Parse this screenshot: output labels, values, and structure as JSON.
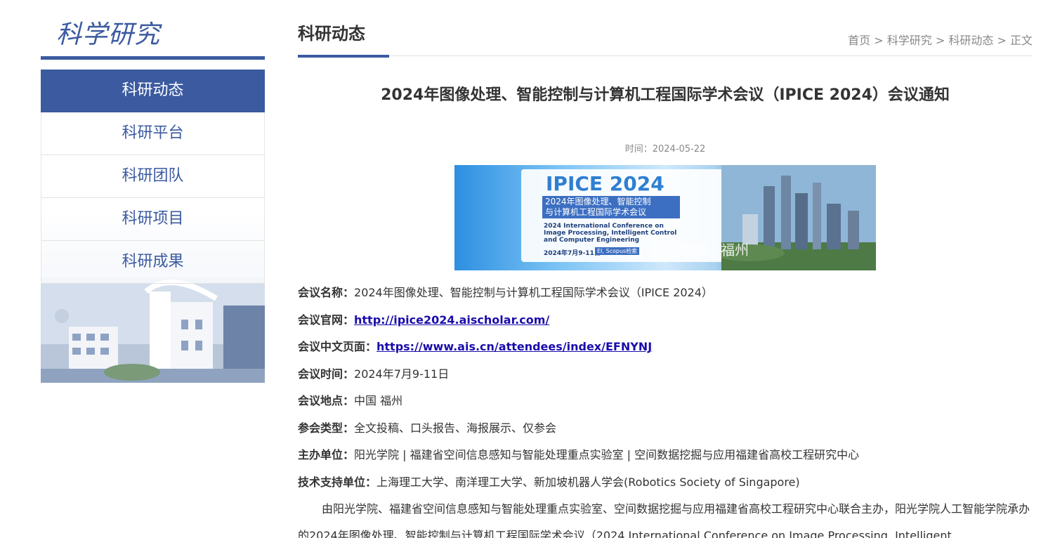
{
  "sidebar": {
    "title": "科学研究",
    "items": [
      {
        "label": "科研动态",
        "active": true
      },
      {
        "label": "科研平台",
        "active": false
      },
      {
        "label": "科研团队",
        "active": false
      },
      {
        "label": "科研项目",
        "active": false
      },
      {
        "label": "科研成果",
        "active": false
      }
    ]
  },
  "main": {
    "heading": "科研动态",
    "breadcrumb": [
      "首页",
      "科学研究",
      "科研动态",
      "正文"
    ],
    "breadcrumb_separator": ">",
    "article": {
      "title": "2024年图像处理、智能控制与计算机工程国际学术会议（IPICE 2024）会议通知",
      "time_label": "时间：",
      "time_value": "2024-05-22",
      "banner": {
        "brand": "IPICE 2024",
        "cn_title_line1": "2024年图像处理、智能控制",
        "cn_title_line2": "与计算机工程国际学术会议",
        "en_line1": "2024 International Conference on",
        "en_line2": "Image Processing, Intelligent Control",
        "en_line3": "and Computer Engineering",
        "date": "2024年7月9-11日",
        "tag": "EI, Scopus检索",
        "city": "中国 · 福州"
      },
      "info": [
        {
          "label": "会议名称：",
          "value": "2024年图像处理、智能控制与计算机工程国际学术会议（IPICE 2024）",
          "is_link": false
        },
        {
          "label": "会议官网：",
          "value": "http://ipice2024.aischolar.com/",
          "is_link": true
        },
        {
          "label": "会议中文页面：",
          "value": "https://www.ais.cn/attendees/index/EFNYNJ",
          "is_link": true
        },
        {
          "label": "会议时间：",
          "value": "2024年7月9-11日",
          "is_link": false
        },
        {
          "label": "会议地点：",
          "value": "中国 福州",
          "is_link": false
        },
        {
          "label": "参会类型：",
          "value": "全文投稿、口头报告、海报展示、仅参会",
          "is_link": false
        },
        {
          "label": "主办单位：",
          "value": "阳光学院 | 福建省空间信息感知与智能处理重点实验室 | 空间数据挖掘与应用福建省高校工程研究中心",
          "is_link": false
        },
        {
          "label": "技术支持单位：",
          "value": "上海理工大学、南洋理工大学、新加坡机器人学会(Robotics Society of Singapore)",
          "is_link": false
        }
      ],
      "paragraph": "由阳光学院、福建省空间信息感知与智能处理重点实验室、空间数据挖掘与应用福建省高校工程研究中心联合主办，阳光学院人工智能学院承办的2024年图像处理、智能控制与计算机工程国际学术会议（2024 International Conference on Image Processing, Intelligent"
    }
  },
  "colors": {
    "accent": "#3b5aa0",
    "link": "#1a0dab",
    "muted": "#888888"
  }
}
